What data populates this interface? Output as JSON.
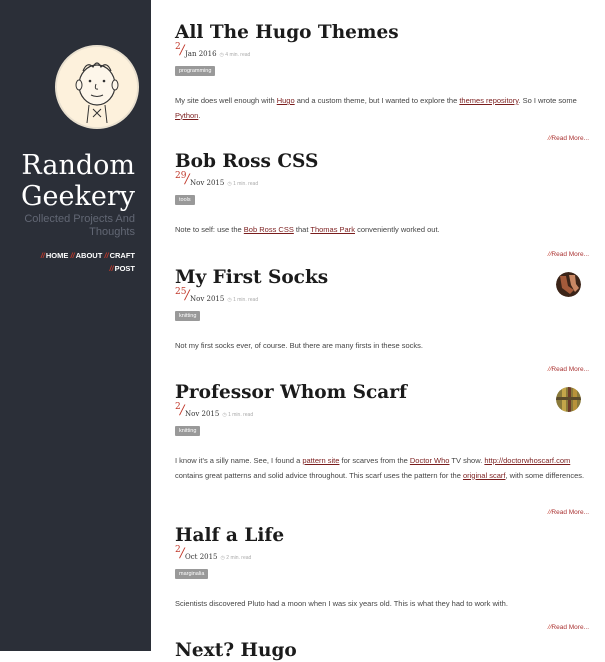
{
  "site": {
    "title_line1": "Random",
    "title_line2": "Geekery",
    "tagline": "Collected Projects And Thoughts"
  },
  "nav": [
    {
      "slash": "//",
      "label": "HOME"
    },
    {
      "slash": "//",
      "label": "ABOUT"
    },
    {
      "slash": "//",
      "label": "CRAFT"
    },
    {
      "slash": "//",
      "label": "POST"
    }
  ],
  "posts": [
    {
      "title": "All The Hugo Themes",
      "day": "2",
      "month_year": "Jan 2016",
      "read_time": "◷ 4 min. read",
      "tag": "programming",
      "summary_parts": [
        {
          "text": "My site does well enough with ",
          "link": false
        },
        {
          "text": "Hugo",
          "link": true
        },
        {
          "text": " and a custom theme, but I wanted to explore the ",
          "link": false
        },
        {
          "text": "themes repository",
          "link": true
        },
        {
          "text": ". So I wrote some ",
          "link": false
        },
        {
          "text": "Python",
          "link": true
        },
        {
          "text": ".",
          "link": false
        }
      ],
      "read_more": "Read More..."
    },
    {
      "title": "Bob Ross CSS",
      "day": "29",
      "month_year": "Nov 2015",
      "read_time": "◷ 1 min. read",
      "tag": "tools",
      "summary_parts": [
        {
          "text": "Note to self: use the ",
          "link": false
        },
        {
          "text": "Bob Ross CSS",
          "link": true
        },
        {
          "text": " that ",
          "link": false
        },
        {
          "text": "Thomas Park",
          "link": true
        },
        {
          "text": " conveniently worked out.",
          "link": false
        }
      ],
      "read_more": "Read More..."
    },
    {
      "title": "My First Socks",
      "day": "25",
      "month_year": "Nov 2015",
      "read_time": "◷ 1 min. read",
      "tag": "knitting",
      "summary_parts": [
        {
          "text": "Not my first socks ever, of course. But there are many firsts in these socks.",
          "link": false
        }
      ],
      "read_more": "Read More..."
    },
    {
      "title": "Professor Whom Scarf",
      "day": "2",
      "month_year": "Nov 2015",
      "read_time": "◷ 1 min. read",
      "tag": "knitting",
      "summary_parts": [
        {
          "text": "I know it's a silly name. See, I found a ",
          "link": false
        },
        {
          "text": "pattern site",
          "link": true
        },
        {
          "text": " for scarves from the ",
          "link": false
        },
        {
          "text": "Doctor Who",
          "link": true
        },
        {
          "text": " TV show. ",
          "link": false
        },
        {
          "text": "http://doctorwhoscarf.com",
          "link": true
        },
        {
          "text": " contains great patterns and solid advice throughout. This scarf uses the pattern for the ",
          "link": false
        },
        {
          "text": "original scarf",
          "link": true
        },
        {
          "text": ", with some differences.",
          "link": false
        }
      ],
      "read_more": "Read More..."
    },
    {
      "title": "Half a Life",
      "day": "2",
      "month_year": "Oct 2015",
      "read_time": "◷ 2 min. read",
      "tag": "marginalia",
      "summary_parts": [
        {
          "text": "Scientists discovered Pluto had a moon when I was six years old. This is what they had to work with.",
          "link": false
        }
      ],
      "read_more": "Read More..."
    },
    {
      "title": "Next? Hugo",
      "day": "",
      "month_year": "",
      "read_time": "",
      "tag": "",
      "summary_parts": [],
      "read_more": ""
    }
  ],
  "colors": {
    "sidebar": "#2b2f38",
    "accent": "#c0392b",
    "link": "#7a1d1d",
    "tag_bg": "#999999"
  },
  "icons": {
    "read_time": "clock-icon",
    "socks_thumb": "socks-thumbnail",
    "scarf_thumb": "scarf-thumbnail"
  }
}
